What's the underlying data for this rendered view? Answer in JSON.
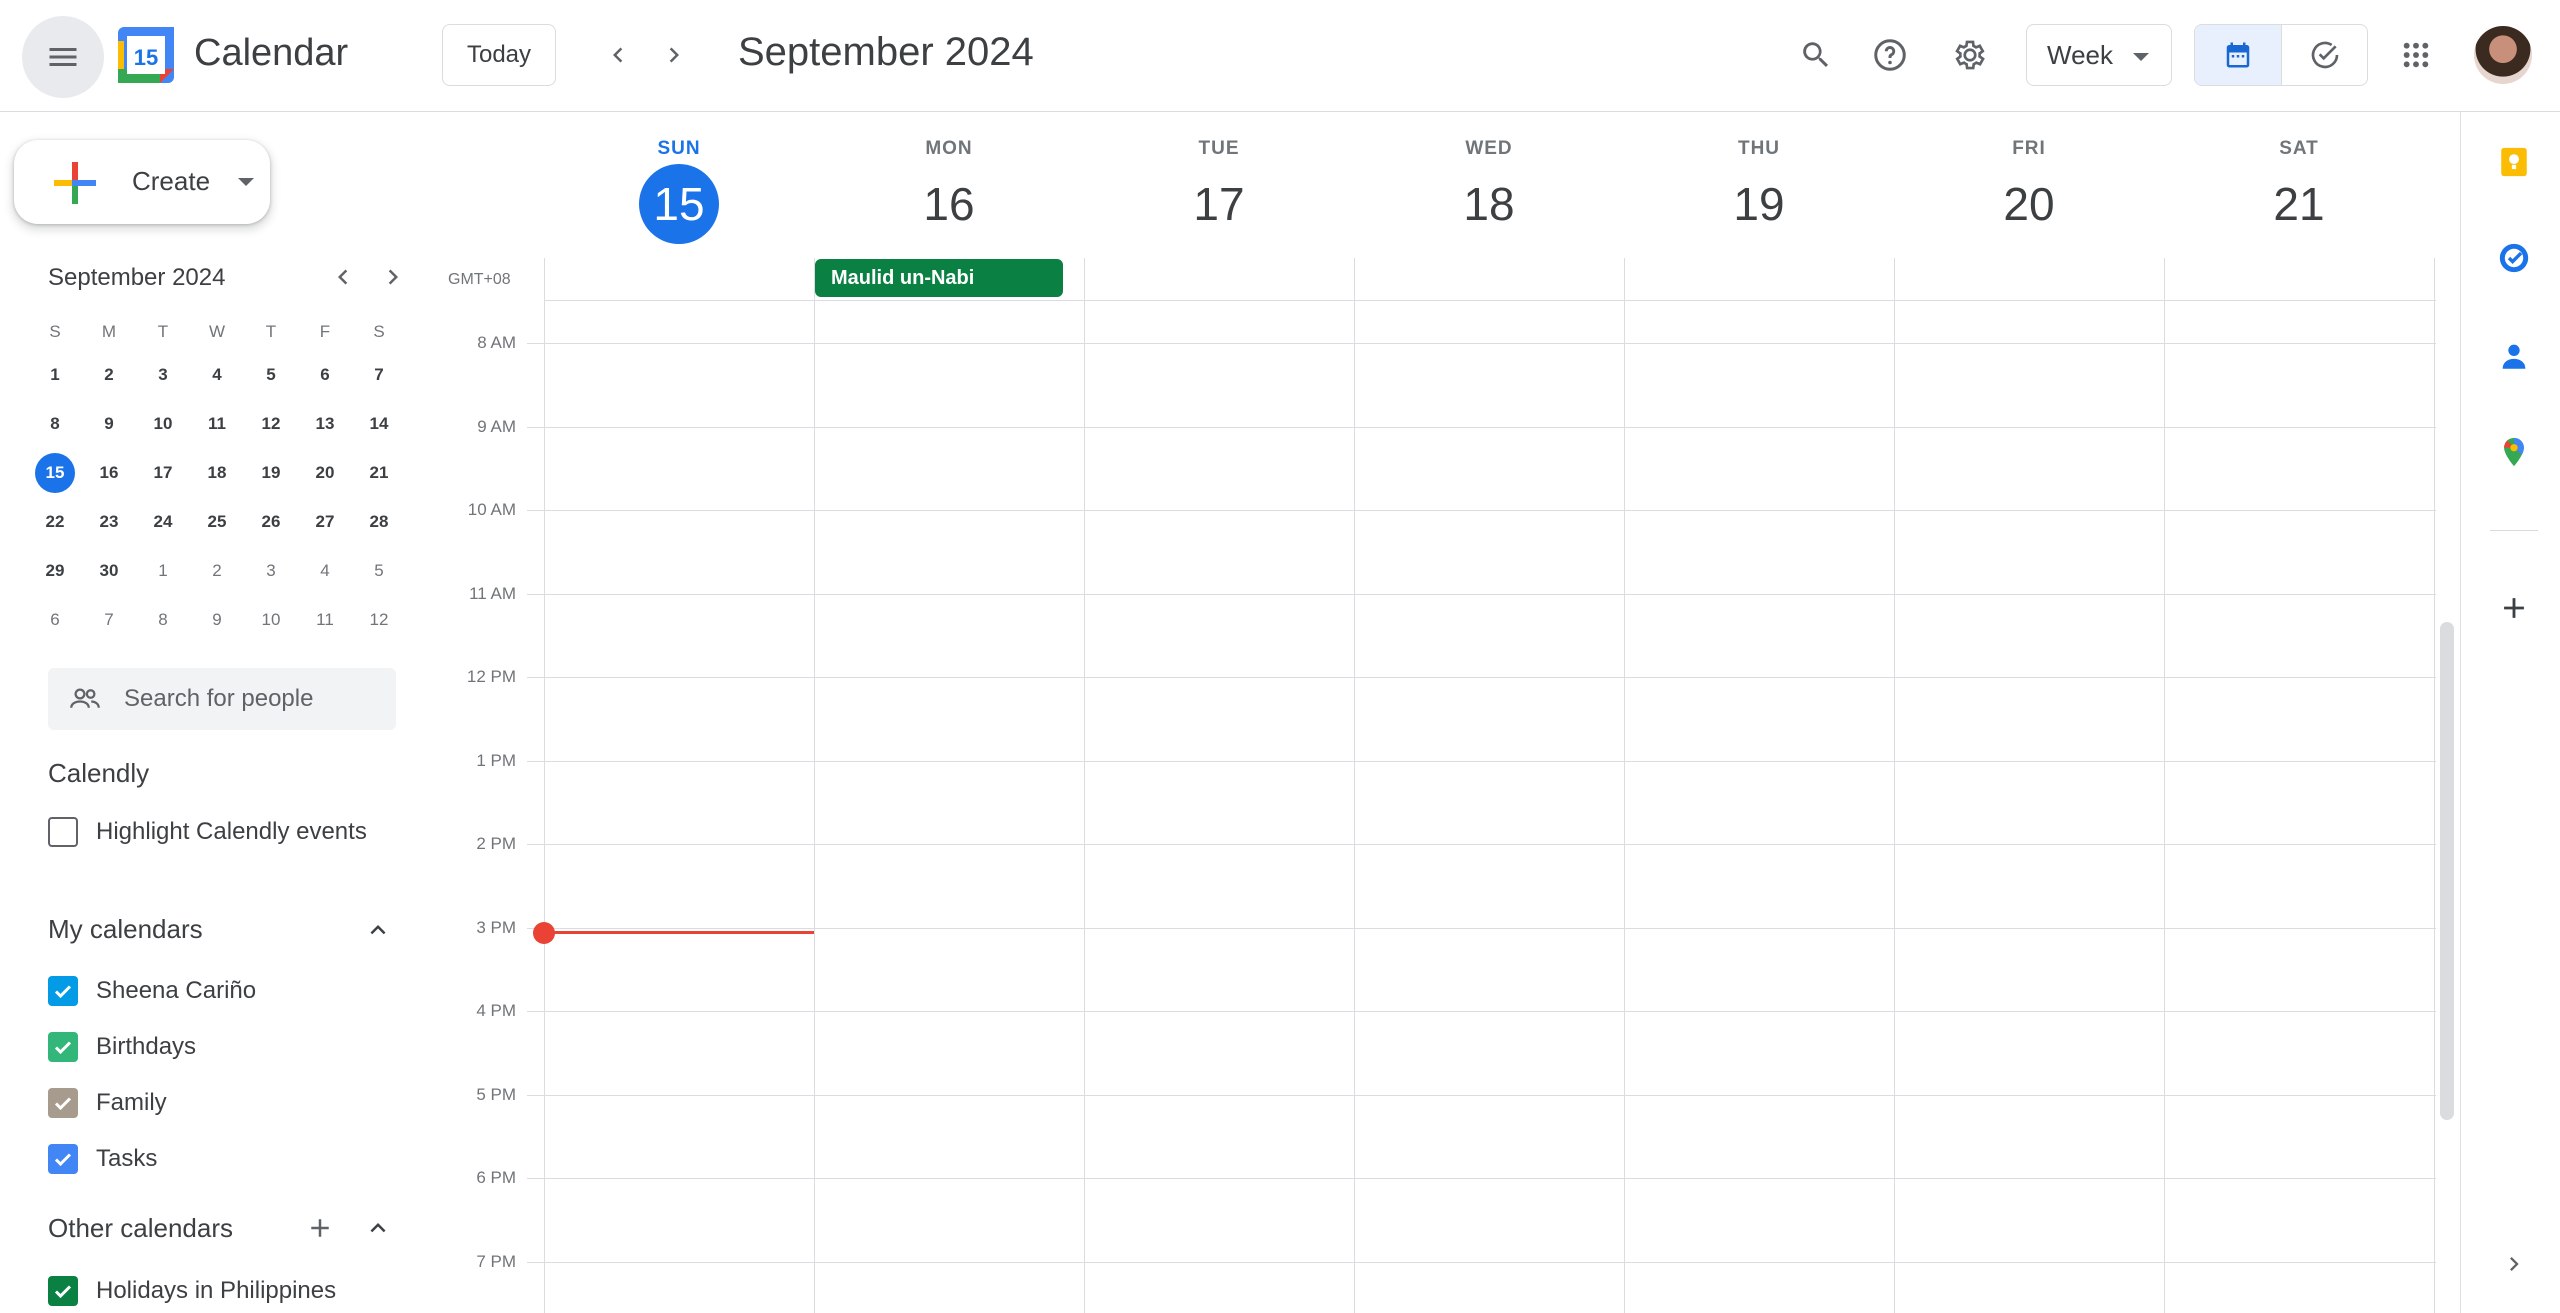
{
  "app": {
    "title": "Calendar",
    "logo_number": "15"
  },
  "header": {
    "today_label": "Today",
    "current_range": "September 2024",
    "view_selected": "Week"
  },
  "sidebar": {
    "create_label": "Create",
    "mini_calendar": {
      "title": "September 2024",
      "weekday_initials": [
        "S",
        "M",
        "T",
        "W",
        "T",
        "F",
        "S"
      ],
      "weeks": [
        [
          "1",
          "2",
          "3",
          "4",
          "5",
          "6",
          "7"
        ],
        [
          "8",
          "9",
          "10",
          "11",
          "12",
          "13",
          "14"
        ],
        [
          "15",
          "16",
          "17",
          "18",
          "19",
          "20",
          "21"
        ],
        [
          "22",
          "23",
          "24",
          "25",
          "26",
          "27",
          "28"
        ],
        [
          "29",
          "30",
          "1",
          "2",
          "3",
          "4",
          "5"
        ],
        [
          "6",
          "7",
          "8",
          "9",
          "10",
          "11",
          "12"
        ]
      ],
      "today": "15"
    },
    "people_search_placeholder": "Search for people",
    "calendly": {
      "title": "Calendly",
      "option": "Highlight Calendly events"
    },
    "my_calendars": {
      "title": "My calendars",
      "items": [
        {
          "label": "Sheena Cariño",
          "color": "#039be5",
          "checked": true
        },
        {
          "label": "Birthdays",
          "color": "#33b679",
          "checked": true
        },
        {
          "label": "Family",
          "color": "#a79b8e",
          "checked": true
        },
        {
          "label": "Tasks",
          "color": "#4285f4",
          "checked": true
        }
      ]
    },
    "other_calendars": {
      "title": "Other calendars",
      "items": [
        {
          "label": "Holidays in Philippines",
          "color": "#0b8043",
          "checked": true
        }
      ]
    }
  },
  "week": {
    "timezone": "GMT+08",
    "days": [
      {
        "dow": "SUN",
        "num": "15",
        "today": true
      },
      {
        "dow": "MON",
        "num": "16"
      },
      {
        "dow": "TUE",
        "num": "17"
      },
      {
        "dow": "WED",
        "num": "18"
      },
      {
        "dow": "THU",
        "num": "19"
      },
      {
        "dow": "FRI",
        "num": "20"
      },
      {
        "dow": "SAT",
        "num": "21"
      }
    ],
    "hours": [
      "8 AM",
      "9 AM",
      "10 AM",
      "11 AM",
      "12 PM",
      "1 PM",
      "2 PM",
      "3 PM",
      "4 PM",
      "5 PM",
      "6 PM",
      "7 PM"
    ],
    "all_day_events": [
      {
        "title": "Maulid un-Nabi",
        "day": "MON",
        "color": "#0b8043"
      }
    ]
  },
  "colors": {
    "accent": "#1a73e8",
    "now_indicator": "#ea4335"
  }
}
